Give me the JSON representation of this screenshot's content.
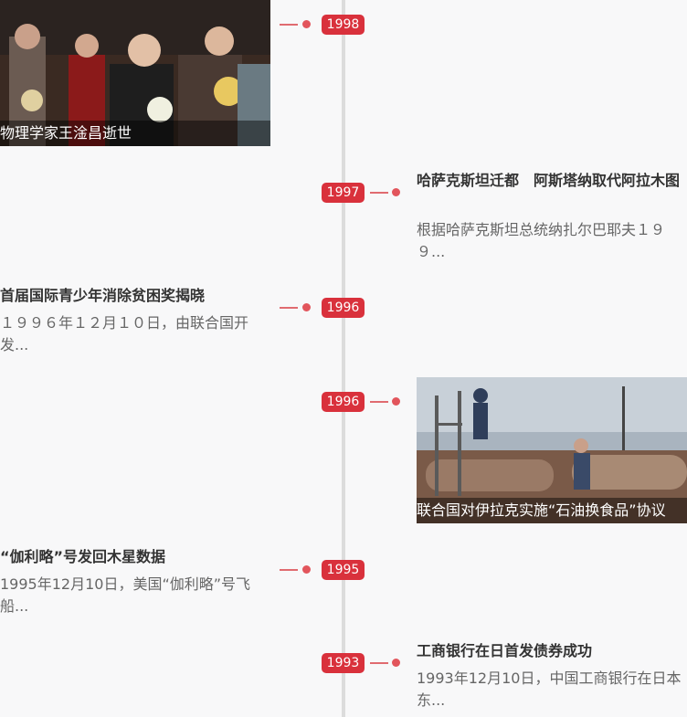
{
  "entries": [
    {
      "year": "1998",
      "title": "物理学家王淦昌逝世",
      "type": "photo",
      "side": "left"
    },
    {
      "year": "1997",
      "title": "哈萨克斯坦迁都　阿斯塔纳取代阿拉木图",
      "desc": "根据哈萨克斯坦总统纳扎尔巴耶夫１９９...",
      "type": "text",
      "side": "right"
    },
    {
      "year": "1996",
      "title": "首届国际青少年消除贫困奖揭晓",
      "desc": "１９９６年１２月１０日，由联合国开发...",
      "type": "text",
      "side": "left"
    },
    {
      "year": "1996",
      "title": "联合国对伊拉克实施“石油换食品”协议",
      "type": "photo",
      "side": "right"
    },
    {
      "year": "1995",
      "title": "“伽利略”号发回木星数据",
      "desc": "1995年12月10日，美国“伽利略”号飞船...",
      "type": "text",
      "side": "left"
    },
    {
      "year": "1993",
      "title": "工商银行在日首发债券成功",
      "desc": "1993年12月10日，中国工商银行在日本东...",
      "type": "text",
      "side": "right"
    }
  ]
}
